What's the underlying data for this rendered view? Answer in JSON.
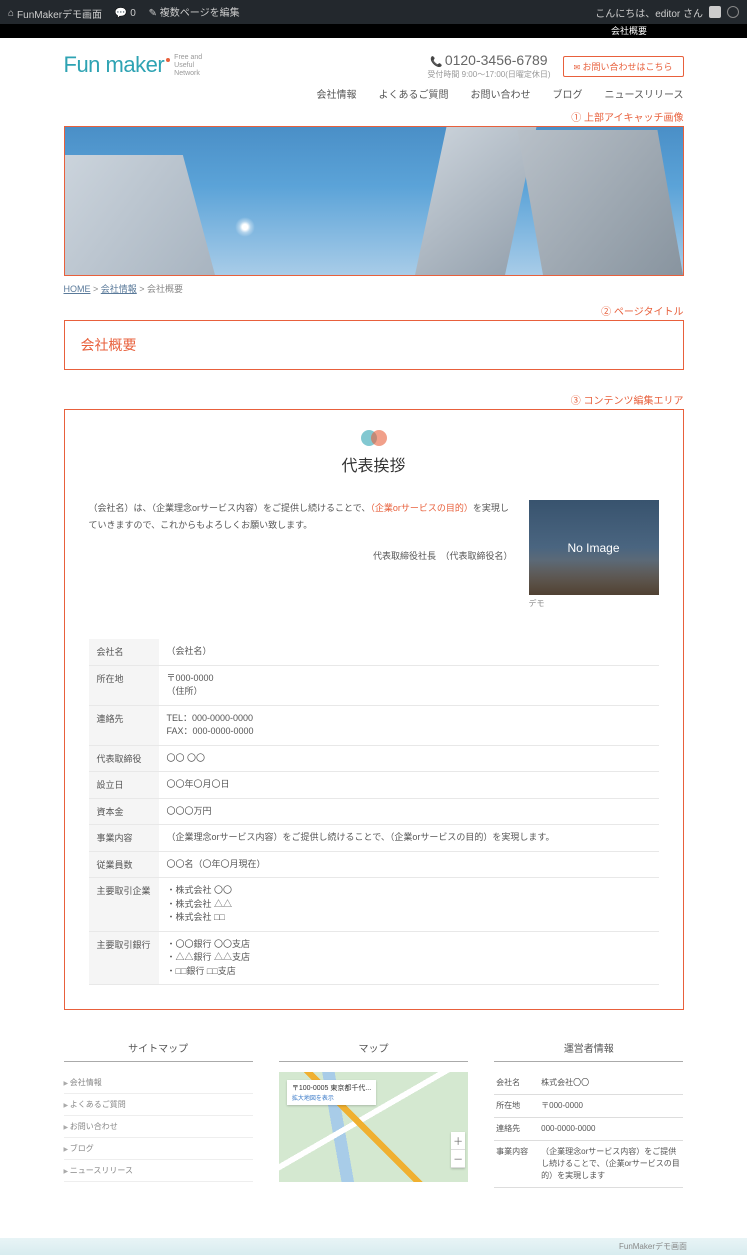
{
  "admin": {
    "site": "FunMakerデモ画面",
    "comment_icon": "💬",
    "comment_count": "0",
    "edit": "✎ 複数ページを編集",
    "greeting": "こんにちは、editor さん"
  },
  "subbar": "会社概要",
  "logo": {
    "fun": "Fun",
    "maker": "maker",
    "sub1": "Free and",
    "sub2": "Useful",
    "sub3": "Network"
  },
  "phone": "0120-3456-6789",
  "hours": "受付時間  9:00～17:00(日曜定休日)",
  "contact_btn": "お問い合わせはこちら",
  "nav": [
    "会社情報",
    "よくあるご質問",
    "お問い合わせ",
    "ブログ",
    "ニュースリリース"
  ],
  "anno": {
    "hero": "① 上部アイキャッチ画像",
    "title": "② ページタイトル",
    "content": "③ コンテンツ編集エリア"
  },
  "breadcrumb": {
    "home": "HOME",
    "sep": " > ",
    "cat": "会社情報",
    "cur": "会社概要"
  },
  "page_title": "会社概要",
  "greeting": {
    "title": "代表挨拶",
    "text1": "（会社名）は、（企業理念orサービス内容）をご提供し続けることで、",
    "text_hl": "（企業orサービスの目的）",
    "text2": "を実現していきますので、これからもよろしくお願い致します。",
    "sig": "代表取締役社長　（代表取締役名）",
    "noimg": "No Image",
    "caption": "デモ"
  },
  "company": [
    {
      "k": "会社名",
      "v": "（会社名）"
    },
    {
      "k": "所在地",
      "v": "〒000-0000\n（住所）"
    },
    {
      "k": "連絡先",
      "v": "TEL：000-0000-0000\nFAX：000-0000-0000"
    },
    {
      "k": "代表取締役",
      "v": "〇〇 〇〇"
    },
    {
      "k": "設立日",
      "v": "〇〇年〇月〇日"
    },
    {
      "k": "資本金",
      "v": "〇〇〇万円"
    },
    {
      "k": "事業内容",
      "v": "（企業理念orサービス内容）をご提供し続けることで、（企業orサービスの目的）を実現します。"
    },
    {
      "k": "従業員数",
      "v": "〇〇名（〇年〇月現在）"
    },
    {
      "k": "主要取引企業",
      "v": "・株式会社 〇〇\n・株式会社 △△\n・株式会社 □□"
    },
    {
      "k": "主要取引銀行",
      "v": "・〇〇銀行 〇〇支店\n・△△銀行 △△支店\n・□□銀行 □□支店"
    }
  ],
  "footer": {
    "sitemap": {
      "h": "サイトマップ",
      "items": [
        "会社情報",
        "よくあるご質問",
        "お問い合わせ",
        "ブログ",
        "ニュースリリース"
      ]
    },
    "map": {
      "h": "マップ",
      "label": "〒100-0005 東京都千代...",
      "zoom": "拡大地図を表示"
    },
    "operator": {
      "h": "運営者情報",
      "rows": [
        {
          "k": "会社名",
          "v": "株式会社〇〇"
        },
        {
          "k": "所在地",
          "v": "〒000-0000"
        },
        {
          "k": "連絡先",
          "v": "000-0000-0000"
        },
        {
          "k": "事業内容",
          "v": "（企業理念orサービス内容）をご提供し続けることで、（企業orサービスの目的）を実現します"
        }
      ]
    }
  },
  "footbar": "FunMakerデモ画面"
}
